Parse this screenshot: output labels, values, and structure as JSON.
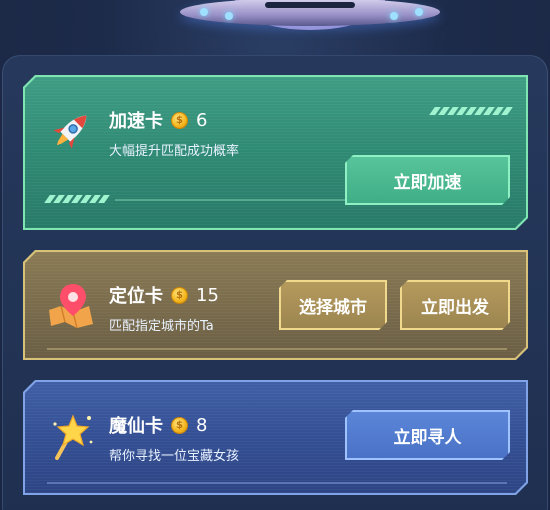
{
  "cards": [
    {
      "title": "加速卡",
      "cost": "6",
      "desc": "大幅提升匹配成功概率",
      "button": "立即加速",
      "icon": "rocket-icon",
      "accent": "#7fe6b2"
    },
    {
      "title": "定位卡",
      "cost": "15",
      "desc": "匹配指定城市的Ta",
      "button_secondary": "选择城市",
      "button": "立即出发",
      "icon": "map-pin-icon",
      "accent": "#d8c27a"
    },
    {
      "title": "魔仙卡",
      "cost": "8",
      "desc": "帮你寻找一位宝藏女孩",
      "button": "立即寻人",
      "icon": "magic-wand-icon",
      "accent": "#7fa3e6"
    }
  ]
}
